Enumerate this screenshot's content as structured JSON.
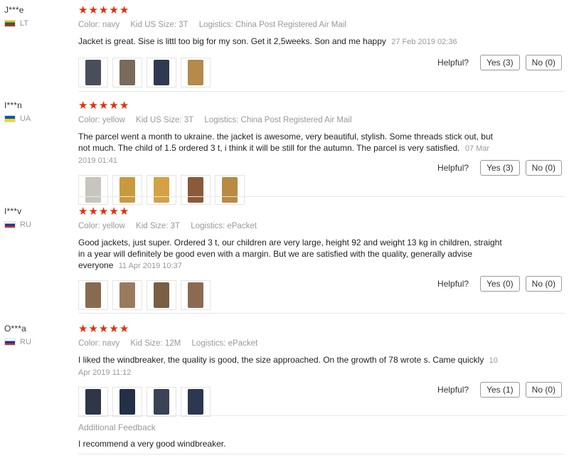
{
  "reviews": [
    {
      "user": "J***e",
      "country": "LT",
      "flag": "lt",
      "rating": 5,
      "color": "Color: navy",
      "size": "Kid US Size: 3T",
      "logistics": "Logistics: China Post Registered Air Mail",
      "text": "Jacket is great. Sise is littl too big for my son. Get it 2,5weeks. Son and me happy",
      "date": "27 Feb 2019 02:36",
      "helpful_label": "Helpful?",
      "yes_label": "Yes (3)",
      "no_label": "No (0)",
      "thumb_colors": [
        "#4a4e5a",
        "#7a6a5c",
        "#2f3a52",
        "#b58a4a"
      ]
    },
    {
      "user": "I***n",
      "country": "UA",
      "flag": "ua",
      "rating": 5,
      "color": "Color: yellow",
      "size": "Kid US Size: 3T",
      "logistics": "Logistics: China Post Registered Air Mail",
      "text": "The parcel went a month to ukraine. the jacket is awesome, very beautiful, stylish. Some threads stick out, but not much. The child of 1.5 ordered 3 t, i think it will be still for the autumn. The parcel is very satisfied.",
      "date": "07 Mar 2019 01:41",
      "helpful_label": "Helpful?",
      "yes_label": "Yes (3)",
      "no_label": "No (0)",
      "thumb_colors": [
        "#c8c4be",
        "#c89a3c",
        "#d4a244",
        "#8a5a3a",
        "#b88a44"
      ]
    },
    {
      "user": "I***v",
      "country": "RU",
      "flag": "ru",
      "rating": 5,
      "color": "Color: yellow",
      "size": "Kid Size: 3T",
      "logistics": "Logistics: ePacket",
      "text": "Good jackets, just super. Ordered 3 t, our children are very large, height 92 and weight 13 kg in children, straight in a year will definitely be good even with a margin. But we are satisfied with the quality, generally advise everyone",
      "date": "11 Apr 2019 10:37",
      "helpful_label": "Helpful?",
      "yes_label": "Yes (0)",
      "no_label": "No (0)",
      "thumb_colors": [
        "#8a6a4e",
        "#9a7a5c",
        "#7a5e44",
        "#8c6a52"
      ]
    },
    {
      "user": "O***a",
      "country": "RU",
      "flag": "ru",
      "rating": 5,
      "color": "Color: navy",
      "size": "Kid Size: 12M",
      "logistics": "Logistics: ePacket",
      "text": "I liked the windbreaker, the quality is good, the size approached. On the growth of 78 wrote s. Came quickly",
      "date": "10 Apr 2019 11:12",
      "helpful_label": "Helpful?",
      "yes_label": "Yes (1)",
      "no_label": "No (0)",
      "thumb_colors": [
        "#2e3648",
        "#243048",
        "#3a4256",
        "#2c3850"
      ],
      "additional_label": "Additional Feedback",
      "additional_text": "I recommend a very good windbreaker."
    }
  ],
  "icons": {
    "star": "star-icon"
  },
  "colors": {
    "star": "#e62e04",
    "muted": "#999999",
    "border": "#999999"
  }
}
